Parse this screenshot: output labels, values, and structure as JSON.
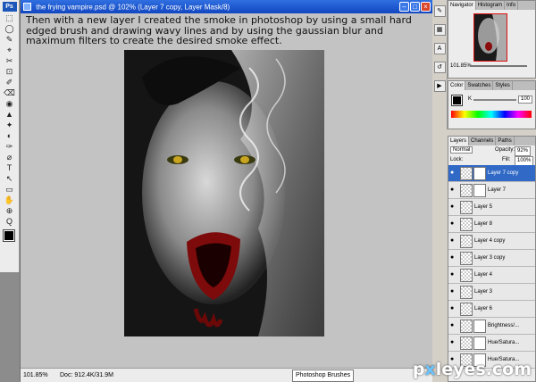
{
  "app": {
    "badge": "Ps"
  },
  "toolbar": {
    "tools": [
      "⬚",
      "◯",
      "✎",
      "⌖",
      "✂",
      "⊡",
      "✐",
      "⌫",
      "◉",
      "▲",
      "✦",
      "◐",
      "✑",
      "⌀",
      "T",
      "↖",
      "▭",
      "✋",
      "⊕",
      "Q"
    ]
  },
  "document": {
    "title": "the frying vampire.psd @ 102% (Layer 7 copy, Layer Mask/8)",
    "caption": "Then with a new layer I created the smoke in photoshop by using a small hard edged brush and drawing wavy lines and by using the gaussian blur and maximum filters to create the desired smoke effect.",
    "status_zoom": "101.85%",
    "status_doc": "Doc: 912.4K/31.9M",
    "status_popup": "Photoshop Brushes"
  },
  "navigator": {
    "tabs": [
      "Navigator",
      "Histogram",
      "Info"
    ],
    "zoom": "101.85%"
  },
  "color": {
    "tabs": [
      "Color",
      "Swatches",
      "Styles"
    ],
    "channel": "K",
    "value": "100"
  },
  "layers": {
    "tabs": [
      "Layers",
      "Channels",
      "Paths"
    ],
    "blend_mode": "Normal",
    "opacity_label": "Opacity:",
    "opacity": "92%",
    "lock_label": "Lock:",
    "fill_label": "Fill:",
    "fill": "100%",
    "items": [
      {
        "name": "Layer 7 copy",
        "selected": true,
        "mask": true
      },
      {
        "name": "Layer 7",
        "selected": false,
        "mask": true
      },
      {
        "name": "Layer 5",
        "selected": false,
        "mask": false
      },
      {
        "name": "Layer 8",
        "selected": false,
        "mask": false
      },
      {
        "name": "Layer 4 copy",
        "selected": false,
        "mask": false
      },
      {
        "name": "Layer 3 copy",
        "selected": false,
        "mask": false
      },
      {
        "name": "Layer 4",
        "selected": false,
        "mask": false
      },
      {
        "name": "Layer 3",
        "selected": false,
        "mask": false
      },
      {
        "name": "Layer 6",
        "selected": false,
        "mask": false
      },
      {
        "name": "Brightness/...",
        "selected": false,
        "mask": true
      },
      {
        "name": "Hue/Satura...",
        "selected": false,
        "mask": true
      },
      {
        "name": "Hue/Satura...",
        "selected": false,
        "mask": true
      }
    ]
  },
  "watermark": {
    "text_a": "p",
    "text_x": "x",
    "text_b": "leyes.com"
  },
  "colors": {
    "titlebar": "#1f5ad4",
    "selected_layer": "#3169c6",
    "canvas_bg": "#c3c3c3"
  }
}
